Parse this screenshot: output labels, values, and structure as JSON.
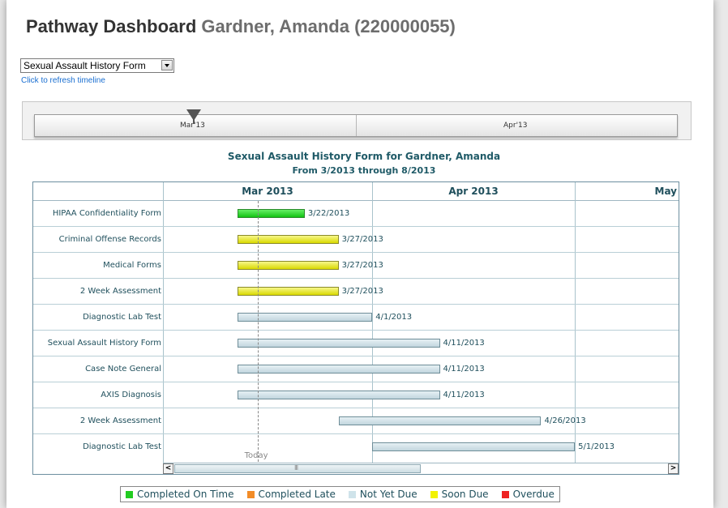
{
  "header": {
    "title": "Pathway Dashboard",
    "patient": "Gardner, Amanda (220000055)"
  },
  "form_select": {
    "value": "Sexual Assault History Form"
  },
  "refresh_link": "Click to refresh timeline",
  "timeline": {
    "labels": [
      "Mar'13",
      "Apr'13"
    ]
  },
  "chart": {
    "title": "Sexual Assault History Form for Gardner, Amanda",
    "subtitle": "From 3/2013 through 8/2013",
    "months": [
      "Mar 2013",
      "Apr 2013",
      "May"
    ],
    "today_label": "Today",
    "scroll_grip": "III",
    "scroll_left": "<",
    "scroll_right": ">"
  },
  "chart_data": {
    "type": "gantt",
    "title": "Sexual Assault History Form for Gardner, Amanda",
    "subtitle": "From 3/2013 through 8/2013",
    "x_start": "2013-03-01",
    "today": "2013-03-15",
    "tasks": [
      {
        "name": "HIPAA Confidentiality Form",
        "start": "2013-03-12",
        "end": "2013-03-22",
        "due_label": "3/22/2013",
        "status": "Completed On Time"
      },
      {
        "name": "Criminal Offense Records",
        "start": "2013-03-12",
        "end": "2013-03-27",
        "due_label": "3/27/2013",
        "status": "Soon Due"
      },
      {
        "name": "Medical Forms",
        "start": "2013-03-12",
        "end": "2013-03-27",
        "due_label": "3/27/2013",
        "status": "Soon Due"
      },
      {
        "name": "2 Week Assessment",
        "start": "2013-03-12",
        "end": "2013-03-27",
        "due_label": "3/27/2013",
        "status": "Soon Due"
      },
      {
        "name": "Diagnostic Lab Test",
        "start": "2013-03-12",
        "end": "2013-04-01",
        "due_label": "4/1/2013",
        "status": "Not Yet Due"
      },
      {
        "name": "Sexual Assault History Form",
        "start": "2013-03-12",
        "end": "2013-04-11",
        "due_label": "4/11/2013",
        "status": "Not Yet Due"
      },
      {
        "name": "Case Note General",
        "start": "2013-03-12",
        "end": "2013-04-11",
        "due_label": "4/11/2013",
        "status": "Not Yet Due"
      },
      {
        "name": "AXIS Diagnosis",
        "start": "2013-03-12",
        "end": "2013-04-11",
        "due_label": "4/11/2013",
        "status": "Not Yet Due"
      },
      {
        "name": "2 Week Assessment",
        "start": "2013-03-27",
        "end": "2013-04-26",
        "due_label": "4/26/2013",
        "status": "Not Yet Due"
      },
      {
        "name": "Diagnostic Lab Test",
        "start": "2013-04-01",
        "end": "2013-05-01",
        "due_label": "5/1/2013",
        "status": "Not Yet Due"
      }
    ],
    "legend": [
      {
        "label": "Completed On Time",
        "color": "#22cc22"
      },
      {
        "label": "Completed Late",
        "color": "#f28c28"
      },
      {
        "label": "Not Yet Due",
        "color": "#cfe3ea"
      },
      {
        "label": "Soon Due",
        "color": "#f2f200"
      },
      {
        "label": "Overdue",
        "color": "#ee2222"
      }
    ]
  }
}
